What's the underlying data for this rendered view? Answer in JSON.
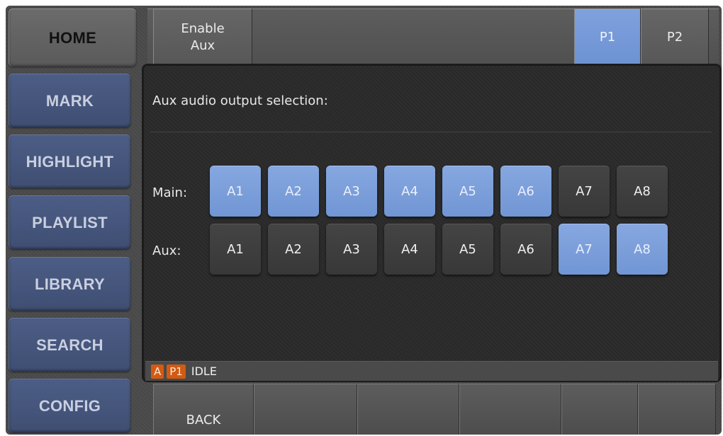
{
  "nav": {
    "home": "HOME",
    "mark": "MARK",
    "highlight": "HIGHLIGHT",
    "playlist": "PLAYLIST",
    "library": "LIBRARY",
    "search": "SEARCH",
    "config": "CONFIG"
  },
  "topbar": {
    "enable_aux": "Enable\nAux",
    "p1": "P1",
    "p2": "P2",
    "active_tab": "P1"
  },
  "panel": {
    "title": "Aux audio output selection:",
    "main_label": "Main:",
    "aux_label": "Aux:",
    "main_channels": [
      {
        "label": "A1",
        "selected": true
      },
      {
        "label": "A2",
        "selected": true
      },
      {
        "label": "A3",
        "selected": true
      },
      {
        "label": "A4",
        "selected": true
      },
      {
        "label": "A5",
        "selected": true
      },
      {
        "label": "A6",
        "selected": true
      },
      {
        "label": "A7",
        "selected": false
      },
      {
        "label": "A8",
        "selected": false
      }
    ],
    "aux_channels": [
      {
        "label": "A1",
        "selected": false
      },
      {
        "label": "A2",
        "selected": false
      },
      {
        "label": "A3",
        "selected": false
      },
      {
        "label": "A4",
        "selected": false
      },
      {
        "label": "A5",
        "selected": false
      },
      {
        "label": "A6",
        "selected": false
      },
      {
        "label": "A7",
        "selected": true
      },
      {
        "label": "A8",
        "selected": true
      }
    ]
  },
  "status": {
    "badge_a": "A",
    "badge_p1": "P1",
    "state": "IDLE"
  },
  "bottom": {
    "back": "BACK"
  },
  "colors": {
    "selected": "#7b9dd9",
    "unselected": "#3e3e3e",
    "nav_blue": "#45557c",
    "status_badge": "#d35a12"
  }
}
